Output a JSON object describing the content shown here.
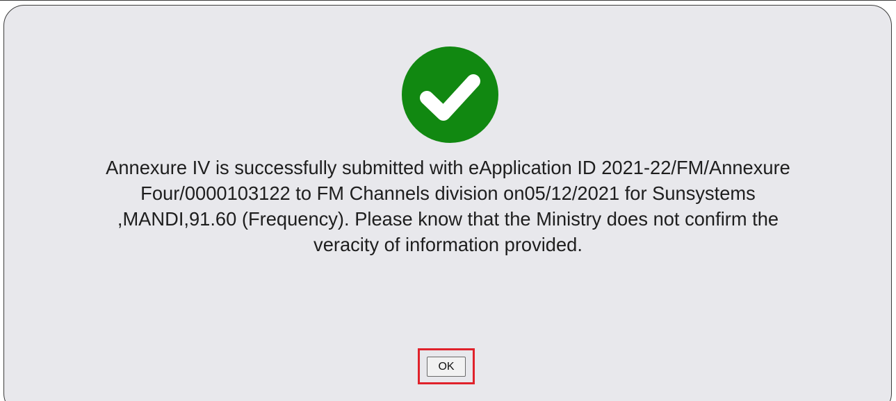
{
  "dialog": {
    "icon": "check-circle-icon",
    "icon_color": "#118811",
    "message_lines": [
      "Annexure IV is successfully submitted with eApplication ID 2021-22/FM/Annexure",
      "Four/0000103122 to FM Channels division on05/12/2021 for Sunsystems",
      ",MANDI,91.60 (Frequency). Please know that the Ministry does not confirm the",
      "veracity of information provided."
    ],
    "ok_label": "OK",
    "highlight_color": "#e0222b"
  }
}
